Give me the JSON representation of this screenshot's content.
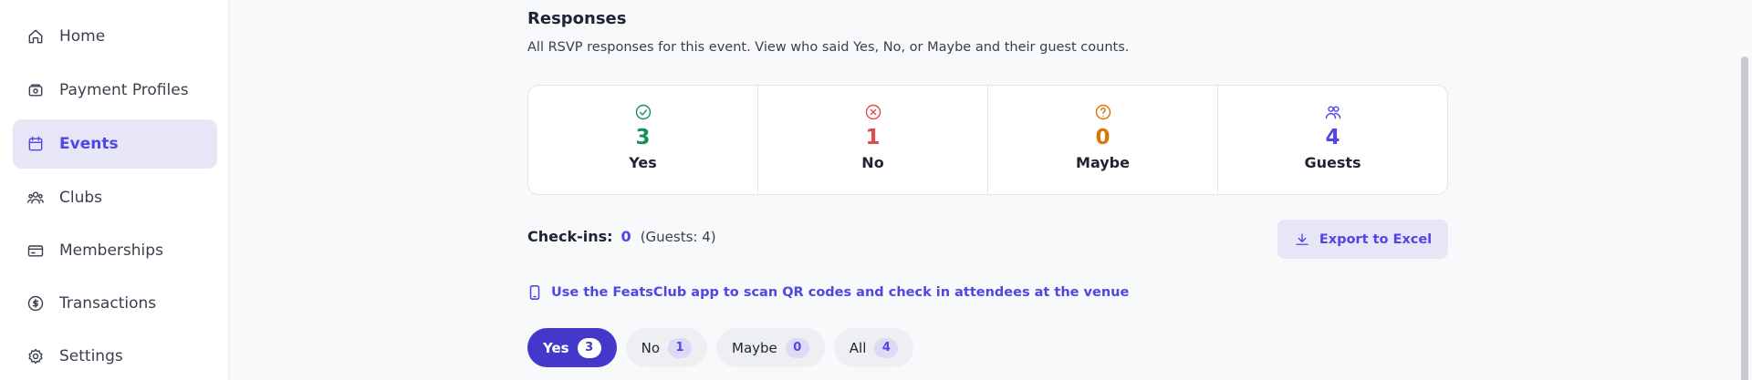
{
  "sidebar": {
    "items": [
      {
        "label": "Home",
        "icon": "home-icon"
      },
      {
        "label": "Payment Profiles",
        "icon": "wallet-icon"
      },
      {
        "label": "Events",
        "icon": "calendar-icon",
        "active": true
      },
      {
        "label": "Clubs",
        "icon": "users-group-icon"
      },
      {
        "label": "Memberships",
        "icon": "card-icon"
      },
      {
        "label": "Transactions",
        "icon": "dollar-circle-icon"
      },
      {
        "label": "Settings",
        "icon": "gear-icon"
      }
    ]
  },
  "responses": {
    "title": "Responses",
    "description": "All RSVP responses for this event. View who said Yes, No, or Maybe and their guest counts.",
    "stats": [
      {
        "label": "Yes",
        "value": "3",
        "color": "#15915a",
        "icon": "check-circle-icon"
      },
      {
        "label": "No",
        "value": "1",
        "color": "#e5484d",
        "icon": "x-circle-icon"
      },
      {
        "label": "Maybe",
        "value": "0",
        "color": "#d97706",
        "icon": "question-circle-icon"
      },
      {
        "label": "Guests",
        "value": "4",
        "color": "#4f46e5",
        "icon": "users-icon"
      }
    ]
  },
  "checkins": {
    "label": "Check-ins:",
    "count": "0",
    "guests": "(Guests: 4)"
  },
  "export_button": {
    "label": "Export to Excel",
    "icon": "download-icon"
  },
  "app_note": {
    "text": "Use the FeatsClub app to scan QR codes and check in attendees at the venue",
    "icon": "phone-icon"
  },
  "filters": [
    {
      "label": "Yes",
      "count": "3",
      "active": true
    },
    {
      "label": "No",
      "count": "1"
    },
    {
      "label": "Maybe",
      "count": "0"
    },
    {
      "label": "All",
      "count": "4"
    }
  ],
  "colors": {
    "accent": "#4f46e5",
    "active_filter": "#4338ca"
  }
}
